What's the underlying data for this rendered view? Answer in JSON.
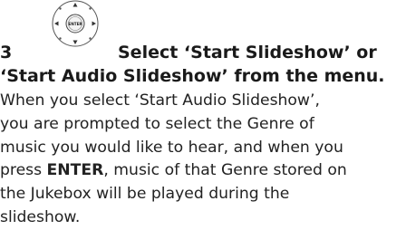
{
  "step": {
    "number": "3",
    "dial_label": "ENTER",
    "heading_line1": "Select ‘Start Slideshow’ or",
    "heading_line2": "‘Start Audio Slideshow’ from the menu."
  },
  "body": {
    "line1": "When you select ‘Start Audio Slideshow’,",
    "line2": "you are prompted to select the Genre of",
    "line3": "music you would like to hear, and when you",
    "line4_prefix": "press ",
    "line4_bold": "ENTER",
    "line4_suffix": ", music of that Genre stored on",
    "line5": "the Jukebox will be played during the",
    "line6": "slideshow."
  },
  "colors": {
    "text": "#1a1a1a",
    "dial_outline": "#444444"
  },
  "icons": [
    "enter-dial-icon"
  ]
}
